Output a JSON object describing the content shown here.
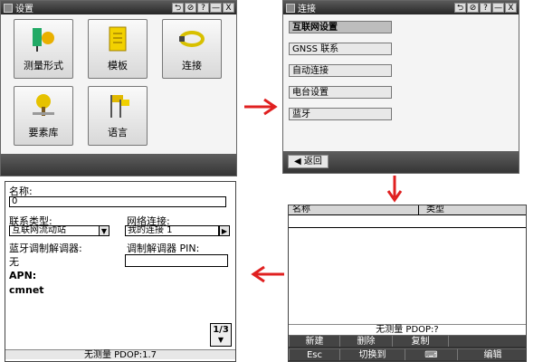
{
  "w1": {
    "title": "设置",
    "buttons": [
      "⮌",
      "⊘",
      "?",
      "—",
      "X"
    ],
    "tiles": [
      {
        "label": "测量形式",
        "icon": "survey-style-icon"
      },
      {
        "label": "模板",
        "icon": "template-icon"
      },
      {
        "label": "连接",
        "icon": "connect-cable-icon"
      },
      {
        "label": "要素库",
        "icon": "feature-library-icon"
      },
      {
        "label": "语言",
        "icon": "language-flags-icon"
      }
    ]
  },
  "w2": {
    "title": "连接",
    "buttons": [
      "⮌",
      "⊘",
      "?",
      "—",
      "X"
    ],
    "items": [
      "互联网设置",
      "GNSS 联系",
      "自动连接",
      "电台设置",
      "蓝牙"
    ],
    "back": "返回"
  },
  "w3": {
    "columns": [
      "名称",
      "类型"
    ],
    "status": "无测量  PDOP:?",
    "row1": [
      "新建",
      "删除",
      "复制"
    ],
    "row2": [
      "Esc",
      "切换到",
      "⌨",
      "编辑"
    ]
  },
  "w4": {
    "name_label": "名称:",
    "name_value": "0",
    "type_label": "联系类型:",
    "type_value": "互联网流动站",
    "net_label": "网络连接:",
    "net_value": "我的连接 1",
    "bt_label": "蓝牙调制解调器:",
    "bt_value": "无",
    "pin_label": "调制解调器 PIN:",
    "pin_value": "",
    "apn_label": "APN:",
    "apn_value": "cmnet",
    "page": "1/3",
    "status": "无测量  PDOP:1.7"
  },
  "colors": {
    "arrow": "#e02020",
    "titlebar": "#2f2f2f",
    "bottombar": "#4a4a4a"
  }
}
